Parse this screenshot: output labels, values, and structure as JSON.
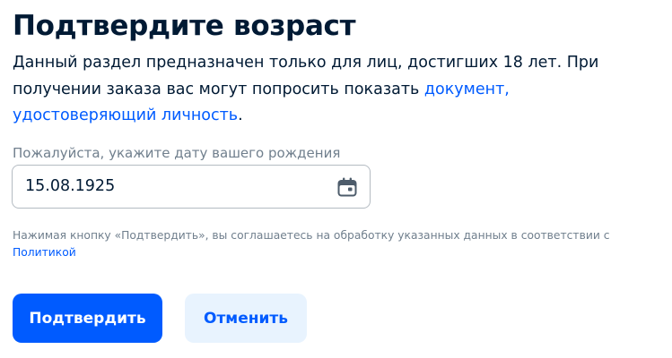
{
  "title": "Подтвердите возраст",
  "description": {
    "text": "Данный раздел предназначен только для лиц, достигших 18 лет. При получении заказа вас могут попросить показать ",
    "link": "документ, удостоверяющий личность",
    "suffix": "."
  },
  "birthdate": {
    "label": "Пожалуйста, укажите дату вашего рождения",
    "value": "15.08.1925",
    "icon": "calendar-icon"
  },
  "consent": {
    "text": "Нажимая кнопку «Подтвердить», вы соглашаетесь на обработку указанных данных в соответствии с ",
    "link": "Политикой"
  },
  "buttons": {
    "confirm": "Подтвердить",
    "cancel": "Отменить"
  },
  "colors": {
    "accent": "#005bff",
    "text": "#001a34",
    "muted": "#707f8d",
    "secondary_bg": "#e8f3fe",
    "border": "#b4bbc2",
    "icon": "#4d5c6b"
  }
}
